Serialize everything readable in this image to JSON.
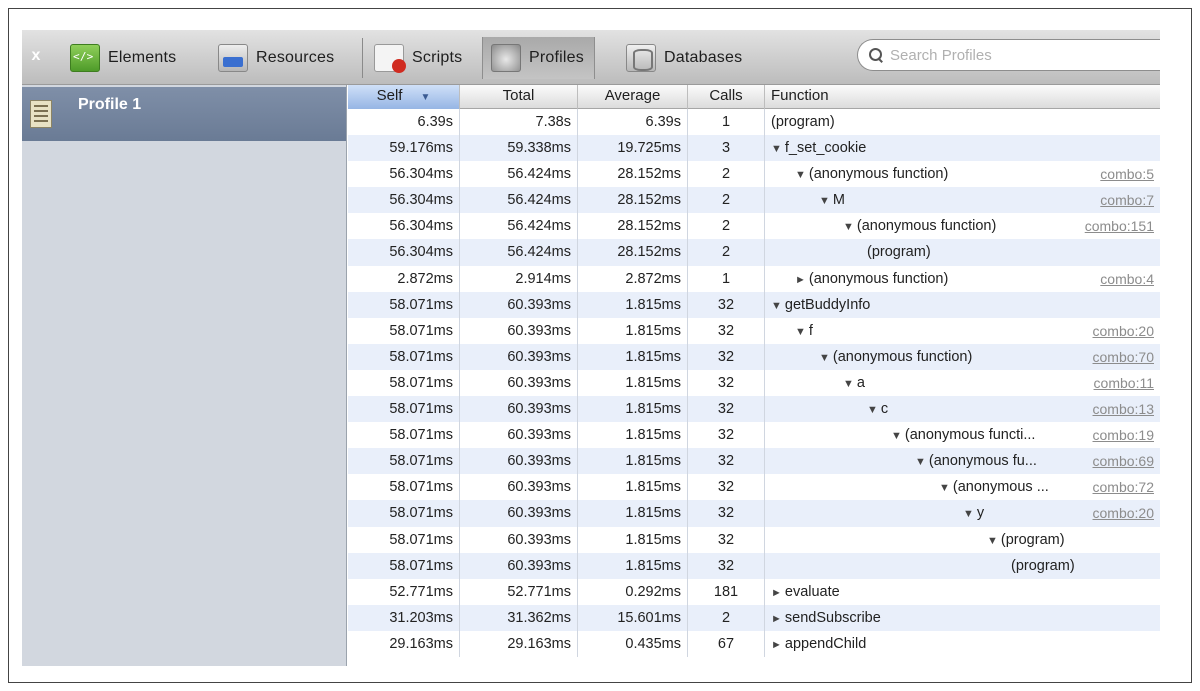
{
  "toolbar": {
    "close_glyph": "x",
    "buttons": [
      {
        "label": "Elements",
        "icon": "elements-icon"
      },
      {
        "label": "Resources",
        "icon": "resources-icon"
      },
      {
        "label": "Scripts",
        "icon": "scripts-icon"
      },
      {
        "label": "Profiles",
        "icon": "profiles-icon"
      },
      {
        "label": "Databases",
        "icon": "databases-icon"
      }
    ],
    "search_placeholder": "Search Profiles"
  },
  "sidebar": {
    "items": [
      {
        "label": "Profile 1",
        "icon": "profile-icon"
      }
    ]
  },
  "grid": {
    "columns": {
      "self": "Self",
      "total": "Total",
      "average": "Average",
      "calls": "Calls",
      "function": "Function"
    },
    "sort_arrow": "▼",
    "rows": [
      {
        "self": "6.39s",
        "total": "7.38s",
        "average": "6.39s",
        "calls": "1",
        "tri": "",
        "fn": "(program)",
        "src": "",
        "depth": 0
      },
      {
        "self": "59.176ms",
        "total": "59.338ms",
        "average": "19.725ms",
        "calls": "3",
        "tri": "▼",
        "fn": "f_set_cookie",
        "src": "",
        "depth": 0
      },
      {
        "self": "56.304ms",
        "total": "56.424ms",
        "average": "28.152ms",
        "calls": "2",
        "tri": "▼",
        "fn": "(anonymous function)",
        "src": "combo:5",
        "depth": 1
      },
      {
        "self": "56.304ms",
        "total": "56.424ms",
        "average": "28.152ms",
        "calls": "2",
        "tri": "▼",
        "fn": "M",
        "src": "combo:7",
        "depth": 2
      },
      {
        "self": "56.304ms",
        "total": "56.424ms",
        "average": "28.152ms",
        "calls": "2",
        "tri": "▼",
        "fn": "(anonymous function)",
        "src": "combo:151",
        "depth": 3
      },
      {
        "self": "56.304ms",
        "total": "56.424ms",
        "average": "28.152ms",
        "calls": "2",
        "tri": "",
        "fn": "(program)",
        "src": "",
        "depth": 4
      },
      {
        "self": "2.872ms",
        "total": "2.914ms",
        "average": "2.872ms",
        "calls": "1",
        "tri": "►",
        "fn": "(anonymous function)",
        "src": "combo:4",
        "depth": 1
      },
      {
        "self": "58.071ms",
        "total": "60.393ms",
        "average": "1.815ms",
        "calls": "32",
        "tri": "▼",
        "fn": "getBuddyInfo",
        "src": "",
        "depth": 0
      },
      {
        "self": "58.071ms",
        "total": "60.393ms",
        "average": "1.815ms",
        "calls": "32",
        "tri": "▼",
        "fn": "f",
        "src": "combo:20",
        "depth": 1
      },
      {
        "self": "58.071ms",
        "total": "60.393ms",
        "average": "1.815ms",
        "calls": "32",
        "tri": "▼",
        "fn": "(anonymous function)",
        "src": "combo:70",
        "depth": 2
      },
      {
        "self": "58.071ms",
        "total": "60.393ms",
        "average": "1.815ms",
        "calls": "32",
        "tri": "▼",
        "fn": "a",
        "src": "combo:11",
        "depth": 3
      },
      {
        "self": "58.071ms",
        "total": "60.393ms",
        "average": "1.815ms",
        "calls": "32",
        "tri": "▼",
        "fn": "c",
        "src": "combo:13",
        "depth": 4
      },
      {
        "self": "58.071ms",
        "total": "60.393ms",
        "average": "1.815ms",
        "calls": "32",
        "tri": "▼",
        "fn": "(anonymous functi...",
        "src": "combo:19",
        "depth": 5
      },
      {
        "self": "58.071ms",
        "total": "60.393ms",
        "average": "1.815ms",
        "calls": "32",
        "tri": "▼",
        "fn": "(anonymous fu...",
        "src": "combo:69",
        "depth": 6
      },
      {
        "self": "58.071ms",
        "total": "60.393ms",
        "average": "1.815ms",
        "calls": "32",
        "tri": "▼",
        "fn": "(anonymous ...",
        "src": "combo:72",
        "depth": 7
      },
      {
        "self": "58.071ms",
        "total": "60.393ms",
        "average": "1.815ms",
        "calls": "32",
        "tri": "▼",
        "fn": "y",
        "src": "combo:20",
        "depth": 8
      },
      {
        "self": "58.071ms",
        "total": "60.393ms",
        "average": "1.815ms",
        "calls": "32",
        "tri": "▼",
        "fn": "(program)",
        "src": "",
        "depth": 9
      },
      {
        "self": "58.071ms",
        "total": "60.393ms",
        "average": "1.815ms",
        "calls": "32",
        "tri": "",
        "fn": "(program)",
        "src": "",
        "depth": 10
      },
      {
        "self": "52.771ms",
        "total": "52.771ms",
        "average": "0.292ms",
        "calls": "181",
        "tri": "►",
        "fn": "evaluate",
        "src": "",
        "depth": 0
      },
      {
        "self": "31.203ms",
        "total": "31.362ms",
        "average": "15.601ms",
        "calls": "2",
        "tri": "►",
        "fn": "sendSubscribe",
        "src": "",
        "depth": 0
      },
      {
        "self": "29.163ms",
        "total": "29.163ms",
        "average": "0.435ms",
        "calls": "67",
        "tri": "►",
        "fn": "appendChild",
        "src": "",
        "depth": 0
      }
    ]
  }
}
